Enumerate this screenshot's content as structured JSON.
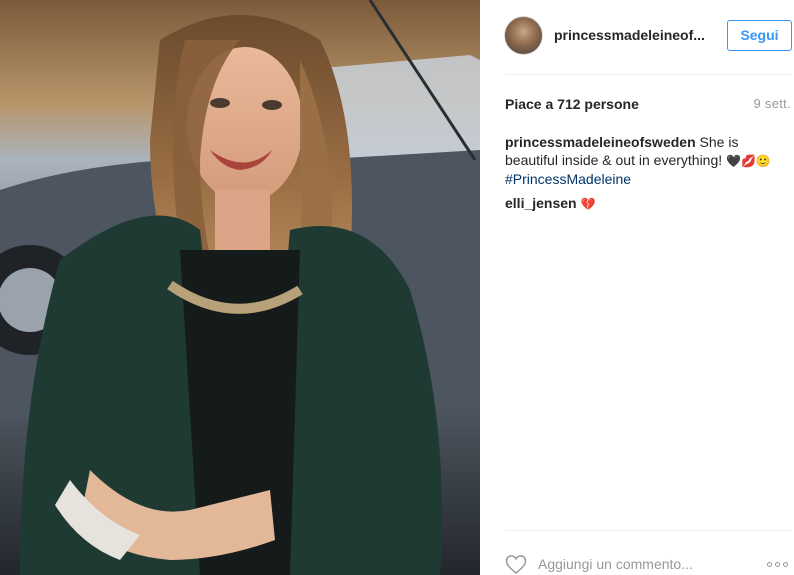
{
  "post": {
    "username": "princessmadeleineof...",
    "follow_label": "Segui",
    "likes_text": "Piace a 712 persone",
    "time_ago": "9 sett."
  },
  "comments": [
    {
      "author": "princessmadeleineofsweden",
      "text": "She is beautiful inside & out in everything!",
      "emoji": "🖤💋🙂",
      "hashtag": "#PrincessMadeleine"
    },
    {
      "author": "elli_jensen",
      "emoji": "💔"
    }
  ],
  "comment_box": {
    "placeholder": "Aggiungi un commento..."
  },
  "icons": {
    "like": "heart-outline-icon",
    "options": "more-options-icon"
  },
  "colors": {
    "accent": "#3897f0",
    "hashtag": "#003569",
    "muted": "#999999",
    "divider": "#efefef"
  }
}
